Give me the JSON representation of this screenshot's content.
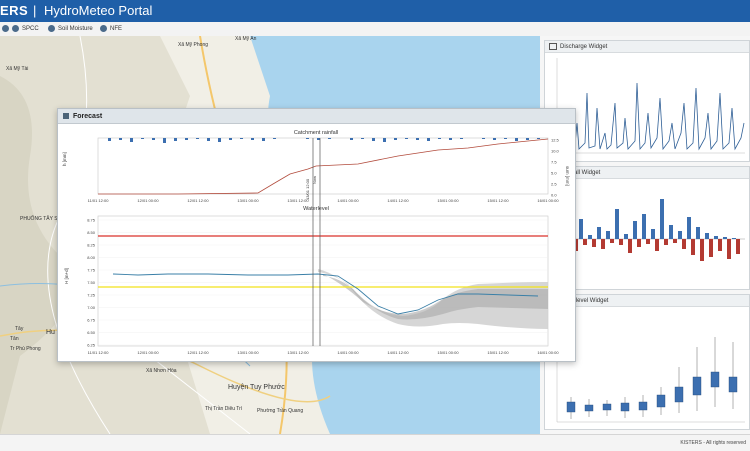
{
  "header": {
    "brand": "ERS",
    "separator": "|",
    "title": "HydroMeteo Portal"
  },
  "toolbar": [
    {
      "label": "",
      "icon": "globe-icon"
    },
    {
      "label": "SPCC",
      "icon": "globe-icon"
    },
    {
      "label": "Soil Moisture",
      "icon": "globe-icon"
    },
    {
      "label": "NFE",
      "icon": "globe-icon"
    }
  ],
  "map": {
    "labels": [
      "Xã Mỹ Phong",
      "Xã Mỹ An",
      "Xã Nhơn Hòa",
      "Huyện Tuy Phước",
      "Phường Trần Quang",
      "Tây",
      "Tân",
      "Tr Phú Phong",
      "Hu",
      "Xã Mỹ Tài",
      "PHUỐNG TÂY SƠN",
      "Thị Trần Diêu Trì"
    ]
  },
  "forecast": {
    "title": "Forecast",
    "rainfall_title": "Catchment rainfall",
    "waterlevel_title": "Waterlevel",
    "rain_axis_left": "h [mm]",
    "rain_axis_right": "sum [mm]",
    "wl_axis": "H [m+d]",
    "x_ticks_top": [
      "11/01 12:00",
      "12/01 00:00",
      "12/01 12:00",
      "13/01 00:00",
      "13/01 12:00",
      "14/01 00:00",
      "14/01 12:00",
      "15/01 00:00",
      "15/01 12:00",
      "16/01 00:00"
    ],
    "x_ticks_bottom": [
      "11/01 12:00",
      "12/01 00:00",
      "12/01 12:00",
      "13/01 00:00",
      "13/01 12:00",
      "14/01 00:00",
      "14/01 12:00",
      "15/01 00:00",
      "15/01 12:00",
      "16/01 00:00"
    ],
    "wl_ticks": [
      "8.75",
      "8.50",
      "8.25",
      "8.00",
      "7.75",
      "7.50",
      "7.25",
      "7.00",
      "6.75",
      "6.50",
      "6.25"
    ],
    "rain_right_ticks": [
      "12.5",
      "10.0",
      "7.5",
      "5.0",
      "2.5",
      "0.0"
    ],
    "vline_labels": [
      "13/01 12:00",
      "Now"
    ],
    "colors": {
      "red_line": "#d9322b",
      "yellow_line": "#f2e21b",
      "ensemble": "#cfcfcf",
      "observed": "#3a7fa7",
      "rain_bars": "#3c6fb0",
      "cum": "#b24b3c"
    }
  },
  "widgets": [
    {
      "title": "Discharge Widget",
      "icon": "chart-icon"
    },
    {
      "title": "Rainfall Widget",
      "icon": "chart-icon"
    },
    {
      "title": "Waterlevel Widget",
      "icon": "chart-icon"
    }
  ],
  "footer": {
    "copyright": "KISTERS - All rights reserved"
  }
}
